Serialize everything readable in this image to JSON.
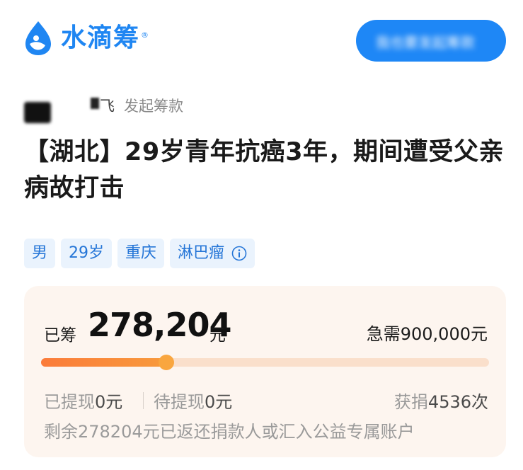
{
  "header": {
    "brand_name": "水滴筹",
    "brand_registered": "®",
    "brand_color": "#1f86f2",
    "logo_icon": "water-drop-icon",
    "cta_label": "我也要发起筹款"
  },
  "initiator": {
    "name": "飞",
    "suffix": "发起筹款"
  },
  "campaign": {
    "title": "【湖北】29岁青年抗癌3年，期间遭受父亲病故打击",
    "tags": [
      "男",
      "29岁",
      "重庆",
      "淋巴瘤"
    ],
    "info_icon": "info-icon"
  },
  "progress": {
    "raised_label": "已筹",
    "raised_amount": "278,204",
    "raised_unit": "元",
    "target_text": "急需900,000元",
    "progress_fraction": 0.28,
    "accent_color": "#fb7b3a",
    "withdrawn_label": "已提现",
    "withdrawn_value": "0",
    "withdrawn_unit": "元",
    "pending_label": "待提现",
    "pending_value": "0",
    "pending_unit": "元",
    "donations_label": "获捐",
    "donations_count": "4536",
    "donations_unit": "次",
    "remaining_prefix": "剩余",
    "remaining_amount": "278204",
    "remaining_suffix": "元已返还捐款人或汇入公益专属账户"
  }
}
